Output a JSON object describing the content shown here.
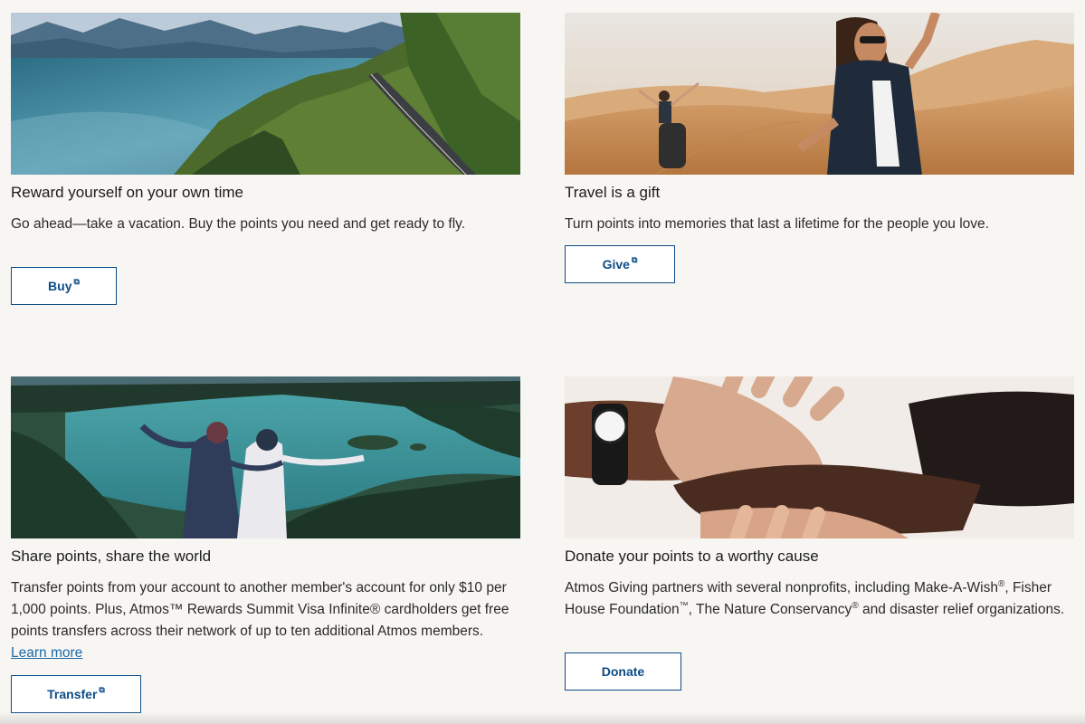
{
  "cards": [
    {
      "title": "Reward yourself on your own time",
      "description": "Go ahead—take a vacation. Buy the points you need and get ready to fly.",
      "button_label": "Buy",
      "image_alt": "Aerial view of coastal highway through forested mountains beside a lake"
    },
    {
      "title": "Travel is a gift",
      "description": "Turn points into memories that last a lifetime for the people you love.",
      "button_label": "Give",
      "image_alt": "Two people with arms raised in sand dunes"
    },
    {
      "title": "Share points, share the world",
      "description": "Transfer points from your account to another member's account for only $10 per 1,000 points. Plus, Atmos™ Rewards Summit Visa Infinite® cardholders get free points transfers across their network of up to ten additional Atmos members.",
      "link_label": "Learn more",
      "button_label": "Transfer",
      "image_alt": "Two friends embracing overlooking a turquoise lake with islands"
    },
    {
      "title": "Donate your points to a worthy cause",
      "desc_part1": "Atmos Giving partners with several nonprofits, including Make-A-Wish",
      "desc_part2": "Fisher House Foundation",
      "desc_part3": ", The Nature Conservancy",
      "desc_part4": " and disaster relief organizations.",
      "reg_mark": "®",
      "tm_mark": "™",
      "button_label": "Donate",
      "image_alt": "Several hands stacked together"
    }
  ],
  "external_icon": "⧉",
  "colors": {
    "background": "#f8f6f3",
    "button_border": "#0d4c86",
    "link": "#1a6aa8"
  }
}
